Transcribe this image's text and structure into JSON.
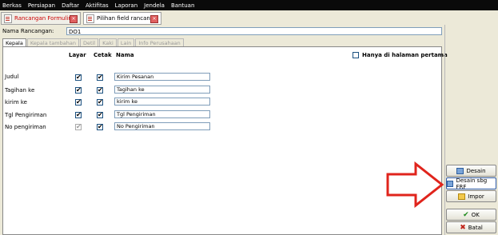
{
  "menu": [
    "Berkas",
    "Persiapan",
    "Daftar",
    "Aktifitas",
    "Laporan",
    "Jendela",
    "Bantuan"
  ],
  "doc_tabs": [
    {
      "label": "Rancangan Formulir"
    },
    {
      "label": "Pilihan field rancan..."
    }
  ],
  "name_field": {
    "label": "Nama Rancangan:",
    "value": "DO1"
  },
  "sub_tabs": [
    "Kepala",
    "Kepala tambahan",
    "Detil",
    "Kaki",
    "Lain",
    "Info Perusahaan"
  ],
  "columns": {
    "layar": "Layar",
    "cetak": "Cetak",
    "nama": "Nama"
  },
  "only_first_page_label": "Hanya di halaman pertama",
  "rows": [
    {
      "label": "Judul",
      "layar": true,
      "cetak": true,
      "nama": "Kirim Pesanan"
    },
    {
      "label": "Tagihan ke",
      "layar": true,
      "cetak": true,
      "nama": "Tagihan ke"
    },
    {
      "label": "kirim ke",
      "layar": true,
      "cetak": true,
      "nama": "kirim ke"
    },
    {
      "label": "Tgl Pengiriman",
      "layar": true,
      "cetak": true,
      "nama": "Tgl Pengiriman"
    },
    {
      "label": "No pengiriman",
      "layar": true,
      "cetak": true,
      "nama": "No Pengiriman"
    }
  ],
  "buttons": {
    "desain": "Desain",
    "desain_frf": "Desain sbg FRF",
    "impor": "Impor",
    "ok": "OK",
    "batal": "Batal"
  },
  "colors": {
    "arrow": "#e0241c",
    "menubar": "#0a0a0a"
  },
  "icons": [
    "monitor-icon",
    "folder-icon",
    "check-icon",
    "x-icon"
  ]
}
